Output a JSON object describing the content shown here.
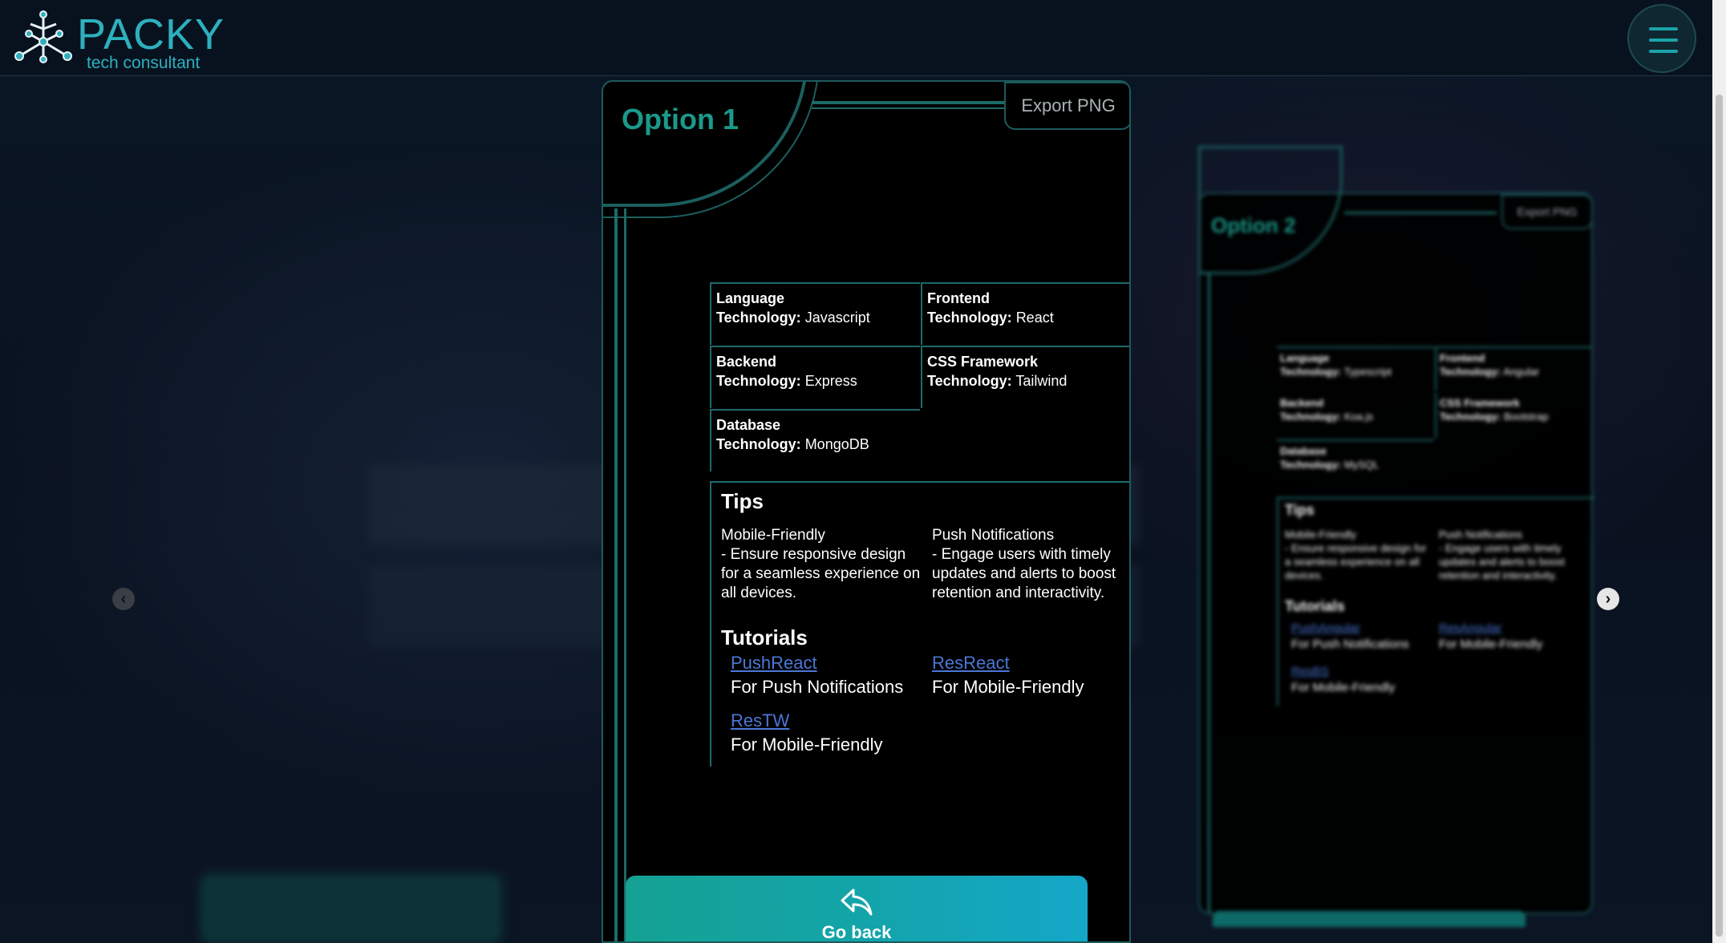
{
  "header": {
    "brand": "PACKY",
    "tagline": "tech consultant"
  },
  "main_card": {
    "title": "Option 1",
    "export_label": "Export PNG",
    "tech": [
      {
        "name": "Language",
        "label": "Technology:",
        "value": "Javascript"
      },
      {
        "name": "Frontend",
        "label": "Technology:",
        "value": "React"
      },
      {
        "name": "Backend",
        "label": "Technology:",
        "value": "Express"
      },
      {
        "name": "CSS Framework",
        "label": "Technology:",
        "value": "Tailwind"
      },
      {
        "name": "Database",
        "label": "Technology:",
        "value": "MongoDB"
      }
    ],
    "tips_title": "Tips",
    "tips": [
      {
        "title": "Mobile-Friendly",
        "text": "- Ensure responsive design for a seamless experience on all devices."
      },
      {
        "title": "Push Notifications",
        "text": "- Engage users with timely updates and alerts to boost retention and interactivity."
      }
    ],
    "tutorials_title": "Tutorials",
    "tutorials": [
      {
        "link": "PushReact",
        "for": "For Push Notifications"
      },
      {
        "link": "ResReact",
        "for": "For Mobile-Friendly"
      },
      {
        "link": "ResTW",
        "for": "For Mobile-Friendly"
      }
    ],
    "go_back_label": "Go back"
  },
  "side_card": {
    "title": "Option 2",
    "export_label": "Export PNG",
    "tech": [
      {
        "name": "Language",
        "label": "Technology:",
        "value": "Typescript"
      },
      {
        "name": "Frontend",
        "label": "Technology:",
        "value": "Angular"
      },
      {
        "name": "Backend",
        "label": "Technology:",
        "value": "Koa.js"
      },
      {
        "name": "CSS Framework",
        "label": "Technology:",
        "value": "Bootstrap"
      },
      {
        "name": "Database",
        "label": "Technology:",
        "value": "MySQL"
      }
    ],
    "tips_title": "Tips",
    "tips": [
      {
        "title": "Mobile-Friendly",
        "text": "- Ensure responsive design for a seamless experience on all devices."
      },
      {
        "title": "Push Notifications",
        "text": "- Engage users with timely updates and alerts to boost retention and interactivity."
      }
    ],
    "tutorials_title": "Tutorials",
    "tutorials": [
      {
        "link": "PushAngular",
        "for": "For Push Notifications"
      },
      {
        "link": "ResAngular",
        "for": "For Mobile-Friendly"
      },
      {
        "link": "ResBS",
        "for": "For Mobile-Friendly"
      }
    ]
  },
  "colors": {
    "accent": "#1a9a8a",
    "border": "#1d5a5d",
    "link": "#4a77d6",
    "background": "#0a1422"
  },
  "icons": {
    "prev": "chevron-left-icon",
    "next": "chevron-right-icon",
    "back": "reply-arrow-icon",
    "menu": "hamburger-icon"
  }
}
